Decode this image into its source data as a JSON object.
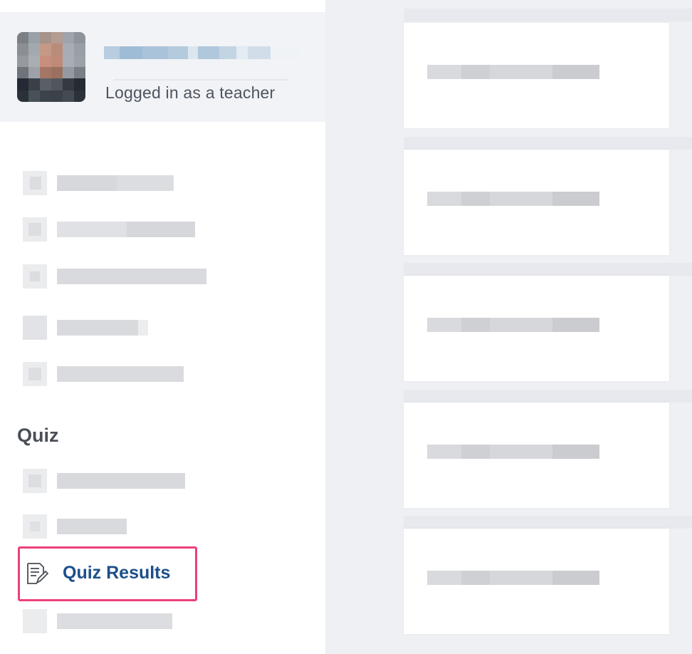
{
  "profile": {
    "name": "",
    "role": "Logged in as a teacher"
  },
  "nav": {
    "items_top": [
      "",
      "",
      "",
      "",
      ""
    ],
    "section_title": "Quiz",
    "items_quiz": [
      "",
      ""
    ],
    "active_label": "Quiz Results",
    "items_after": [
      ""
    ]
  },
  "cards": [
    {
      "title": ""
    },
    {
      "title": ""
    },
    {
      "title": ""
    },
    {
      "title": ""
    },
    {
      "title": ""
    }
  ],
  "colors": {
    "active_border": "#ec3f7a",
    "active_text": "#1d4f8b",
    "role_text": "#4d5560"
  },
  "icons": {
    "active": "document-edit-icon"
  }
}
